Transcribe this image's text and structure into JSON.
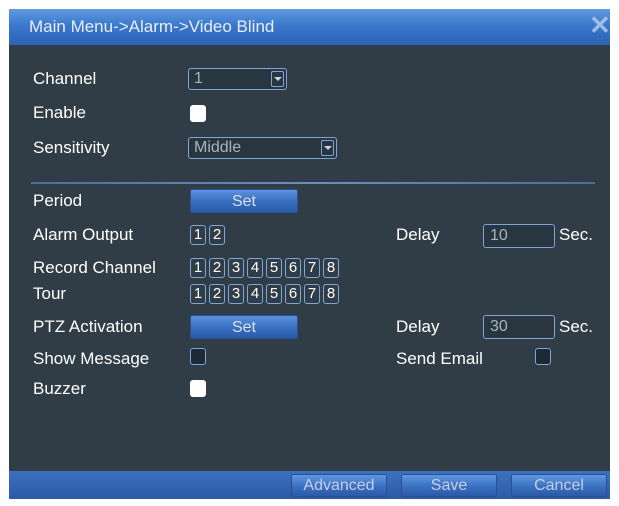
{
  "window": {
    "title": "Main Menu->Alarm->Video Blind",
    "close_glyph": "✕"
  },
  "form": {
    "channel": {
      "label": "Channel",
      "value": "1"
    },
    "enable": {
      "label": "Enable",
      "checked": true
    },
    "sensitivity": {
      "label": "Sensitivity",
      "value": "Middle"
    },
    "period": {
      "label": "Period",
      "button": "Set"
    },
    "alarm_output": {
      "label": "Alarm Output",
      "options": [
        "1",
        "2"
      ]
    },
    "delay1": {
      "label": "Delay",
      "value": "10",
      "unit": "Sec."
    },
    "record_channel": {
      "label": "Record Channel",
      "options": [
        "1",
        "2",
        "3",
        "4",
        "5",
        "6",
        "7",
        "8"
      ]
    },
    "tour": {
      "label": "Tour",
      "options": [
        "1",
        "2",
        "3",
        "4",
        "5",
        "6",
        "7",
        "8"
      ]
    },
    "ptz_activation": {
      "label": "PTZ Activation",
      "button": "Set"
    },
    "delay2": {
      "label": "Delay",
      "value": "30",
      "unit": "Sec."
    },
    "show_message": {
      "label": "Show Message",
      "checked": false
    },
    "send_email": {
      "label": "Send Email",
      "checked": false
    },
    "buzzer": {
      "label": "Buzzer",
      "checked": true
    }
  },
  "footer": {
    "advanced": "Advanced",
    "save": "Save",
    "cancel": "Cancel"
  },
  "colors": {
    "panel": "#303d46",
    "title_bar": "#3b78cc",
    "accent": "#4a86d8",
    "border": "#7fa6d8"
  }
}
